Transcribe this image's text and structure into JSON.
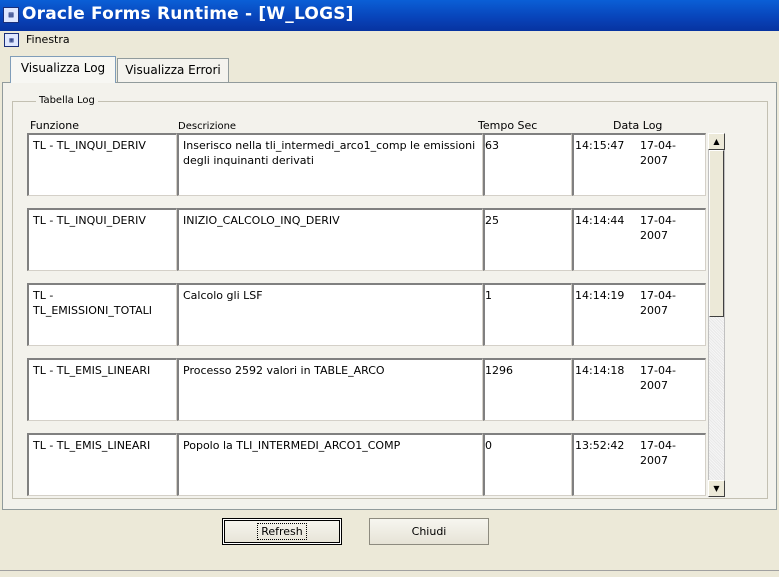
{
  "window": {
    "title": "Oracle Forms Runtime - [W_LOGS]",
    "icon": "oracle-forms-icon"
  },
  "menu": {
    "items": [
      "Finestra"
    ]
  },
  "tabs": [
    {
      "label": "Visualizza Log",
      "active": true
    },
    {
      "label": "Visualizza Errori",
      "active": false
    }
  ],
  "group": {
    "label": "Tabella Log"
  },
  "columns": {
    "funzione": "Funzione",
    "descrizione": "Descrizione",
    "tempo": "Tempo Sec",
    "data": "Data Log"
  },
  "rows": [
    {
      "funzione": "TL - TL_INQUI_DERIV",
      "descrizione": "Inserisco nella tli_intermedi_arco1_comp le emissioni degli inquinanti derivati",
      "tempo": "63",
      "ora": "14:15:47",
      "data": "17-04-2007"
    },
    {
      "funzione": "TL - TL_INQUI_DERIV",
      "descrizione": "INIZIO_CALCOLO_INQ_DERIV",
      "tempo": "25",
      "ora": "14:14:44",
      "data": "17-04-2007"
    },
    {
      "funzione": "TL - TL_EMISSIONI_TOTALI",
      "descrizione": "Calcolo gli LSF",
      "tempo": "1",
      "ora": "14:14:19",
      "data": "17-04-2007"
    },
    {
      "funzione": "TL - TL_EMIS_LINEARI",
      "descrizione": "Processo 2592 valori in TABLE_ARCO",
      "tempo": "1296",
      "ora": "14:14:18",
      "data": "17-04-2007"
    },
    {
      "funzione": "TL - TL_EMIS_LINEARI",
      "descrizione": "Popolo la TLI_INTERMEDI_ARCO1_COMP",
      "tempo": "0",
      "ora": "13:52:42",
      "data": "17-04-2007"
    }
  ],
  "buttons": {
    "refresh": "Refresh",
    "chiudi": "Chiudi"
  }
}
